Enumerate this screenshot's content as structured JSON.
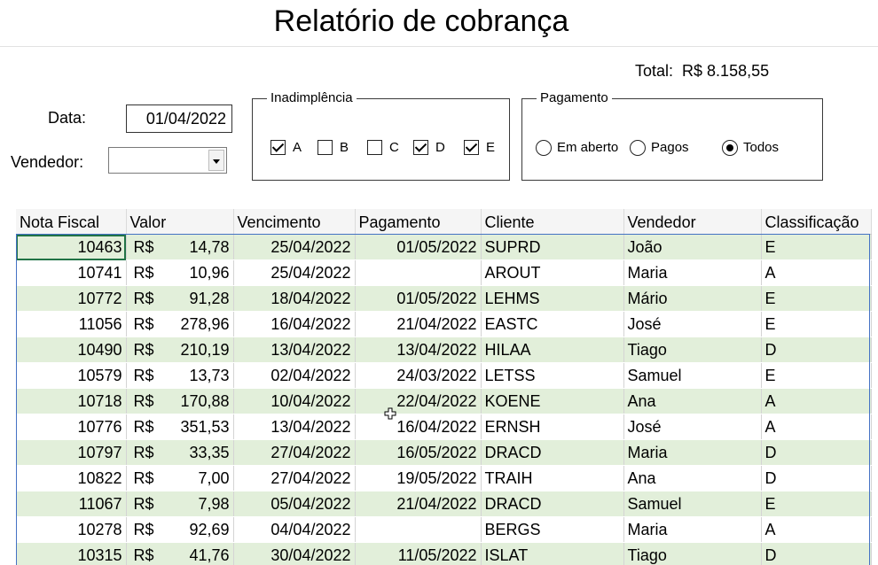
{
  "report": {
    "title": "Relatório de cobrança"
  },
  "total": {
    "label": "Total:",
    "value": "R$ 8.158,55"
  },
  "filters": {
    "date_label": "Data:",
    "date_value": "01/04/2022",
    "seller_label": "Vendedor:",
    "seller_value": ""
  },
  "inadimplencia": {
    "title": "Inadimplência",
    "options": [
      {
        "label": "A",
        "checked": true
      },
      {
        "label": "B",
        "checked": false
      },
      {
        "label": "C",
        "checked": false
      },
      {
        "label": "D",
        "checked": true
      },
      {
        "label": "E",
        "checked": true
      }
    ]
  },
  "pagamento": {
    "title": "Pagamento",
    "options": [
      {
        "label": "Em aberto",
        "selected": false
      },
      {
        "label": "Pagos",
        "selected": false
      },
      {
        "label": "Todos",
        "selected": true
      }
    ]
  },
  "table": {
    "columns": [
      "Nota Fiscal",
      "Valor",
      "Vencimento",
      "Pagamento",
      "Cliente",
      "Vendedor",
      "Classificação"
    ],
    "currency": "R$",
    "rows": [
      {
        "nota": "10463",
        "valor": "14,78",
        "vencimento": "25/04/2022",
        "pagamento": "01/05/2022",
        "cliente": "SUPRD",
        "vendedor": "João",
        "classificacao": "E"
      },
      {
        "nota": "10741",
        "valor": "10,96",
        "vencimento": "25/04/2022",
        "pagamento": "",
        "cliente": "AROUT",
        "vendedor": "Maria",
        "classificacao": "A"
      },
      {
        "nota": "10772",
        "valor": "91,28",
        "vencimento": "18/04/2022",
        "pagamento": "01/05/2022",
        "cliente": "LEHMS",
        "vendedor": "Mário",
        "classificacao": "E"
      },
      {
        "nota": "11056",
        "valor": "278,96",
        "vencimento": "16/04/2022",
        "pagamento": "21/04/2022",
        "cliente": "EASTC",
        "vendedor": "José",
        "classificacao": "E"
      },
      {
        "nota": "10490",
        "valor": "210,19",
        "vencimento": "13/04/2022",
        "pagamento": "13/04/2022",
        "cliente": "HILAA",
        "vendedor": "Tiago",
        "classificacao": "D"
      },
      {
        "nota": "10579",
        "valor": "13,73",
        "vencimento": "02/04/2022",
        "pagamento": "24/03/2022",
        "cliente": "LETSS",
        "vendedor": "Samuel",
        "classificacao": "E"
      },
      {
        "nota": "10718",
        "valor": "170,88",
        "vencimento": "10/04/2022",
        "pagamento": "22/04/2022",
        "cliente": "KOENE",
        "vendedor": "Ana",
        "classificacao": "A"
      },
      {
        "nota": "10776",
        "valor": "351,53",
        "vencimento": "13/04/2022",
        "pagamento": "16/04/2022",
        "cliente": "ERNSH",
        "vendedor": "José",
        "classificacao": "A"
      },
      {
        "nota": "10797",
        "valor": "33,35",
        "vencimento": "27/04/2022",
        "pagamento": "16/05/2022",
        "cliente": "DRACD",
        "vendedor": "Maria",
        "classificacao": "D"
      },
      {
        "nota": "10822",
        "valor": "7,00",
        "vencimento": "27/04/2022",
        "pagamento": "19/05/2022",
        "cliente": "TRAIH",
        "vendedor": "Ana",
        "classificacao": "D"
      },
      {
        "nota": "11067",
        "valor": "7,98",
        "vencimento": "05/04/2022",
        "pagamento": "21/04/2022",
        "cliente": "DRACD",
        "vendedor": "Samuel",
        "classificacao": "E"
      },
      {
        "nota": "10278",
        "valor": "92,69",
        "vencimento": "04/04/2022",
        "pagamento": "",
        "cliente": "BERGS",
        "vendedor": "Maria",
        "classificacao": "A"
      },
      {
        "nota": "10315",
        "valor": "41,76",
        "vencimento": "30/04/2022",
        "pagamento": "11/05/2022",
        "cliente": "ISLAT",
        "vendedor": "Tiago",
        "classificacao": "D"
      }
    ]
  },
  "colors": {
    "band": "#e2efda",
    "table_border": "#4472c4",
    "selection": "#217346"
  },
  "icons": {
    "cursor": "cell-cross-cursor-icon",
    "dropdown": "chevron-down-icon"
  }
}
